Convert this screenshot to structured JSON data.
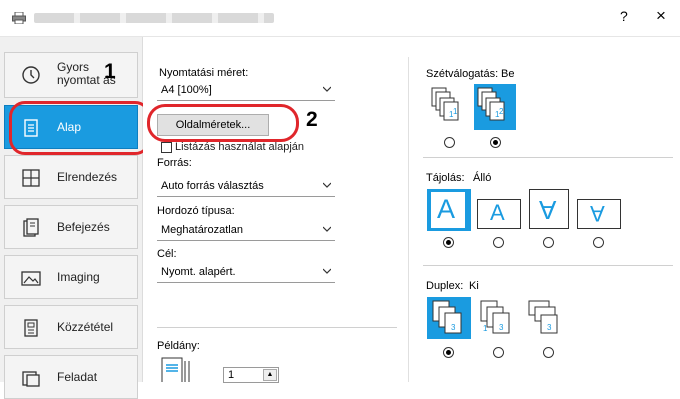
{
  "window": {
    "help_label": "?",
    "close_label": "×"
  },
  "sidebar": {
    "items": [
      {
        "label": "Gyors nyomtat ás",
        "icon": "clock-icon"
      },
      {
        "label": "Alap",
        "icon": "document-icon"
      },
      {
        "label": "Elrendezés",
        "icon": "layout-grid-icon"
      },
      {
        "label": "Befejezés",
        "icon": "finishing-icon"
      },
      {
        "label": "Imaging",
        "icon": "image-icon"
      },
      {
        "label": "Közzététel",
        "icon": "publishing-icon"
      },
      {
        "label": "Feladat",
        "icon": "job-icon"
      }
    ],
    "active_index": 1
  },
  "callouts": {
    "one": "1",
    "two": "2"
  },
  "colors": {
    "accent": "#1a9be0",
    "highlight_ring": "#e0262b"
  },
  "main": {
    "print_size_label": "Nyomtatási méret:",
    "print_size_value": "A4 [100%]",
    "page_sizes_button": "Oldalméretek...",
    "list_based_label": "Listázás használat alapján",
    "source_label": "Forrás:",
    "source_value": "Auto forrás választás",
    "media_type_label": "Hordozó típusa:",
    "media_type_value": "Meghatározatlan",
    "destination_label": "Cél:",
    "destination_value": "Nyomt. alapért.",
    "copies_label": "Példány:",
    "copies_value": "1"
  },
  "right": {
    "collate_label": "Szétválogatás:",
    "collate_value": "Be",
    "orientation_label": "Tájolás:",
    "orientation_value": "Álló",
    "orientation_letter": "A",
    "duplex_label": "Duplex:",
    "duplex_value": "Ki"
  }
}
